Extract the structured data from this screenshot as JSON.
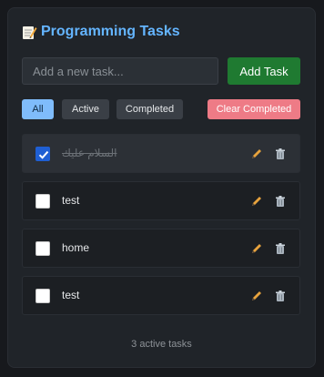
{
  "app": {
    "title": "Programming Tasks",
    "title_icon": "memo-icon"
  },
  "add": {
    "placeholder": "Add a new task...",
    "value": "",
    "button_label": "Add Task"
  },
  "filters": {
    "all_label": "All",
    "active_label": "Active",
    "completed_label": "Completed",
    "clear_label": "Clear Completed",
    "selected": "All"
  },
  "tasks": [
    {
      "label": "السلام عليك",
      "completed": true
    },
    {
      "label": "test",
      "completed": false
    },
    {
      "label": "home",
      "completed": false
    },
    {
      "label": "test",
      "completed": false
    }
  ],
  "footer": {
    "status": "3 active tasks"
  },
  "colors": {
    "accent": "#64b5ff",
    "add_button": "#1f7a31",
    "clear_button": "#ee7b86",
    "filter_active": "#7fbcfb"
  }
}
